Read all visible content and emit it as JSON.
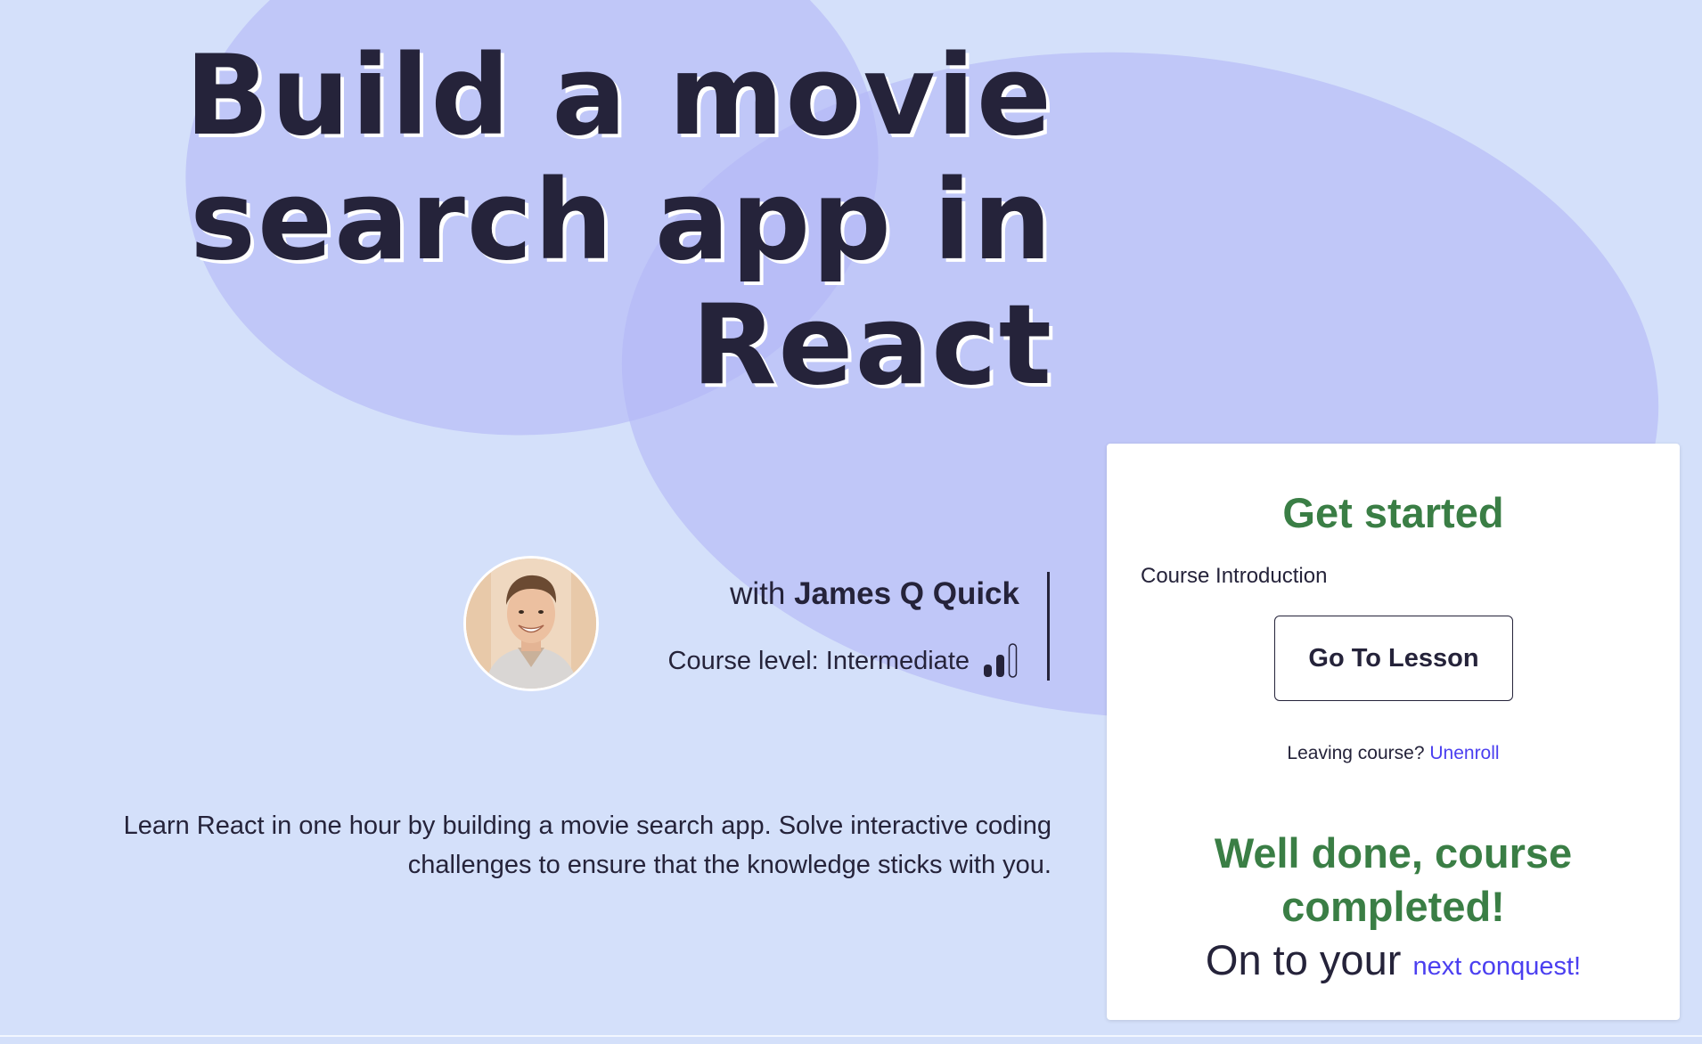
{
  "hero": {
    "title_line1": "Build a movie",
    "title_line2": "search app in",
    "title_line3": "React"
  },
  "instructor": {
    "with_prefix": "with",
    "name": "James Q Quick",
    "level_label": "Course level: Intermediate",
    "level_icon": "signal-bars-icon",
    "level_filled": 2,
    "level_total": 3
  },
  "description": "Learn React in one hour by building a movie search app. Solve interactive coding challenges to ensure that the knowledge sticks with you.",
  "card": {
    "title": "Get started",
    "subtitle": "Course Introduction",
    "button_label": "Go To Lesson",
    "leaving_text": "Leaving course?",
    "unenroll_label": "Unenroll",
    "done_title": "Well done, course completed!",
    "conquest_text": "On to your",
    "next_link_label": "next conquest!"
  },
  "colors": {
    "background": "#d4e0fa",
    "blob": "#b2b6f7",
    "heading_green": "#3a7e45",
    "link_purple": "#4b3ff0",
    "text_dark": "#25233a"
  }
}
